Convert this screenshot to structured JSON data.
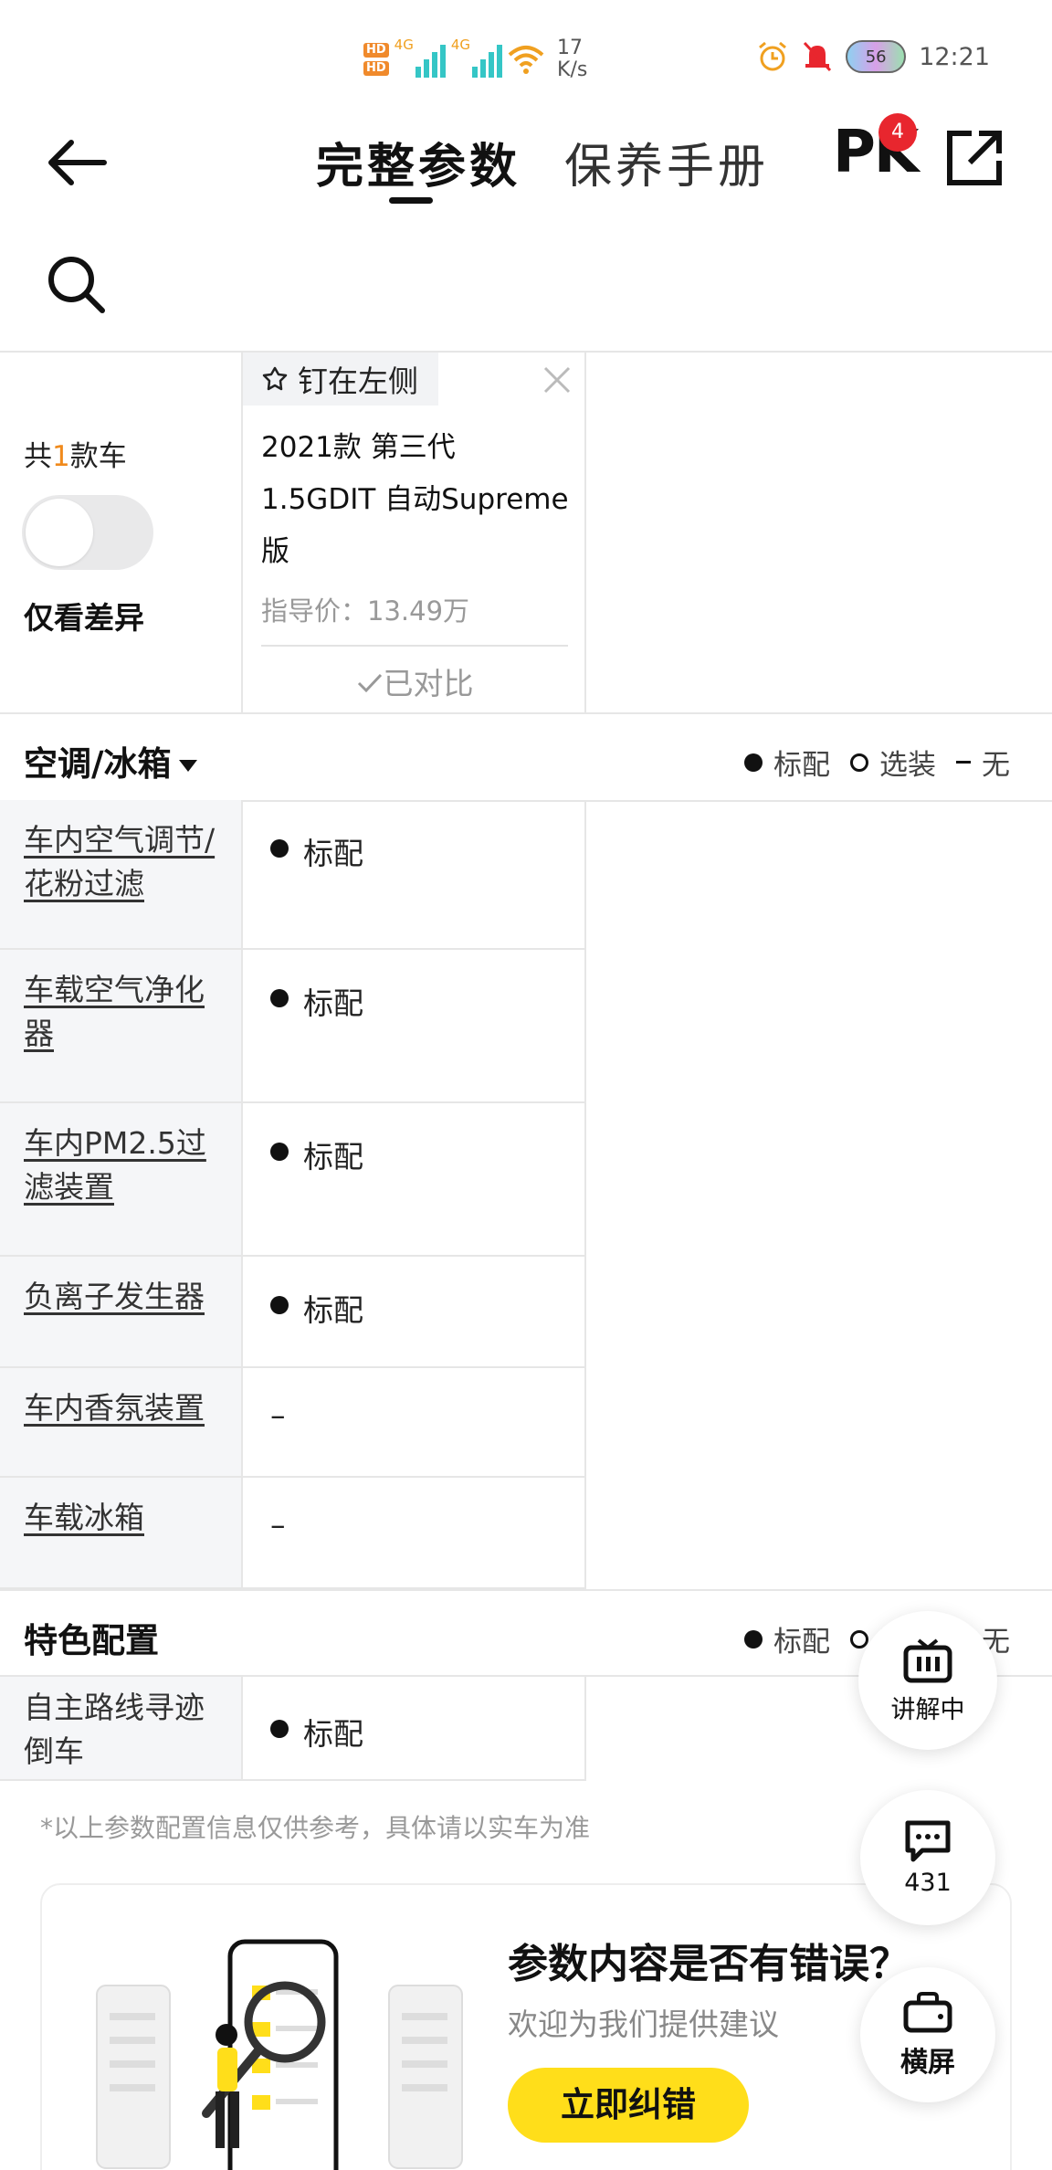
{
  "status_bar": {
    "network_1": "4G",
    "network_2": "4G",
    "speed_value": "17",
    "speed_unit": "K/s",
    "battery": "56",
    "time": "12:21"
  },
  "header": {
    "tab_active": "完整参数",
    "tab_inactive": "保养手册",
    "pk_label": "PK",
    "pk_badge": "4"
  },
  "compare": {
    "count_prefix": "共",
    "count_number": "1",
    "count_suffix": "款车",
    "diff_only_label": "仅看差异",
    "diff_only_on": false
  },
  "car": {
    "pin_label": "钉在左侧",
    "name": "2021款 第三代 1.5GDIT 自动Supreme版",
    "price": "指导价：13.49万",
    "status": "已对比"
  },
  "legend": {
    "standard": "标配",
    "optional": "选装",
    "none": "无"
  },
  "sections": [
    {
      "title": "空调/冰箱",
      "rows": [
        {
          "label": "车内空气调节/花粉过滤",
          "value": "标配",
          "kind": "standard"
        },
        {
          "label": "车载空气净化器",
          "value": "标配",
          "kind": "standard"
        },
        {
          "label": "车内PM2.5过滤装置",
          "value": "标配",
          "kind": "standard"
        },
        {
          "label": "负离子发生器",
          "value": "标配",
          "kind": "standard"
        },
        {
          "label": "车内香氛装置",
          "value": "–",
          "kind": "none"
        },
        {
          "label": "车载冰箱",
          "value": "–",
          "kind": "none"
        }
      ]
    },
    {
      "title": "特色配置",
      "rows": [
        {
          "label": "自主路线寻迹倒车",
          "value": "标配",
          "kind": "standard"
        }
      ]
    }
  ],
  "disclaimer": "*以上参数配置信息仅供参考，具体请以实车为准",
  "feedback": {
    "question": "参数内容是否有错误？",
    "subtitle": "欢迎为我们提供建议",
    "button": "立即纠错"
  },
  "floating": {
    "live_label": "讲解中",
    "comments_count": "431",
    "landscape_label": "横屏"
  },
  "colors": {
    "accent_yellow": "#ffde1a",
    "badge_red": "#e8262e",
    "count_orange": "#f08a1c"
  }
}
